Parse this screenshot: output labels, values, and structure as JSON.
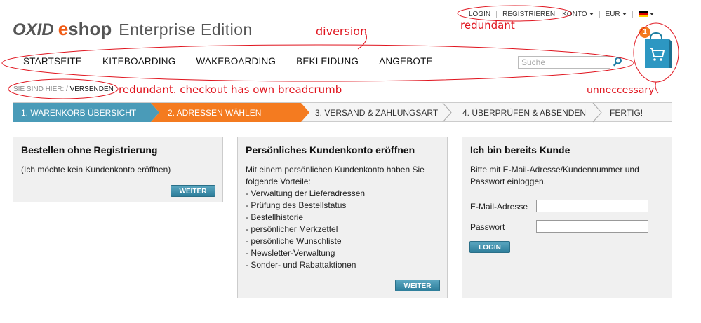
{
  "logo": {
    "part1": "OXID",
    "part2": "e",
    "part3": "shop",
    "edition": "Enterprise Edition"
  },
  "topbar": {
    "login": "LOGIN",
    "register": "REGISTRIEREN",
    "account": "KONTO",
    "currency": "EUR"
  },
  "nav": {
    "items": [
      "STARTSEITE",
      "KITEBOARDING",
      "WAKEBOARDING",
      "BEKLEIDUNG",
      "ANGEBOTE"
    ]
  },
  "search": {
    "placeholder": "Suche"
  },
  "cart": {
    "count": "1"
  },
  "breadcrumb": {
    "label": "SIE SIND HIER:",
    "separator": "/",
    "current": "VERSENDEN"
  },
  "steps": [
    {
      "label": "1. WARENKORB ÜBERSICHT",
      "state": "done"
    },
    {
      "label": "2. ADRESSEN WÄHLEN",
      "state": "active"
    },
    {
      "label": "3. VERSAND & ZAHLUNGSART",
      "state": "todo"
    },
    {
      "label": "4. ÜBERPRÜFEN & ABSENDEN",
      "state": "todo"
    },
    {
      "label": "FERTIG!",
      "state": "todo"
    }
  ],
  "colors": {
    "step_done": "#4a9bb8",
    "step_active": "#f47b20",
    "accent": "#e0141e"
  },
  "guest": {
    "title": "Bestellen ohne Registrierung",
    "text": "(Ich möchte kein Kundenkonto eröffnen)",
    "button": "WEITER"
  },
  "register": {
    "title": "Persönliches Kundenkonto eröffnen",
    "intro1": "Mit einem persönlichen Kundenkonto haben Sie",
    "intro2": "folgende Vorteile:",
    "benefits": [
      "- Verwaltung der Lieferadressen",
      "- Prüfung des Bestellstatus",
      "- Bestellhistorie",
      "- persönlicher Merkzettel",
      "- persönliche Wunschliste",
      "- Newsletter-Verwaltung",
      "- Sonder- und Rabattaktionen"
    ],
    "button": "WEITER"
  },
  "login": {
    "title": "Ich bin bereits Kunde",
    "text1": "Bitte mit E-Mail-Adresse/Kundennummer und",
    "text2": "Passwort einloggen.",
    "email_label": "E-Mail-Adresse",
    "password_label": "Passwort",
    "email_value": "",
    "password_value": "",
    "button": "LOGIN"
  },
  "annotations": {
    "diversion": "diversion",
    "redundant_top": "redundant",
    "redundant_crumb": "redundant. checkout has own breadcrumb",
    "unnecessary": "unneccessary"
  }
}
